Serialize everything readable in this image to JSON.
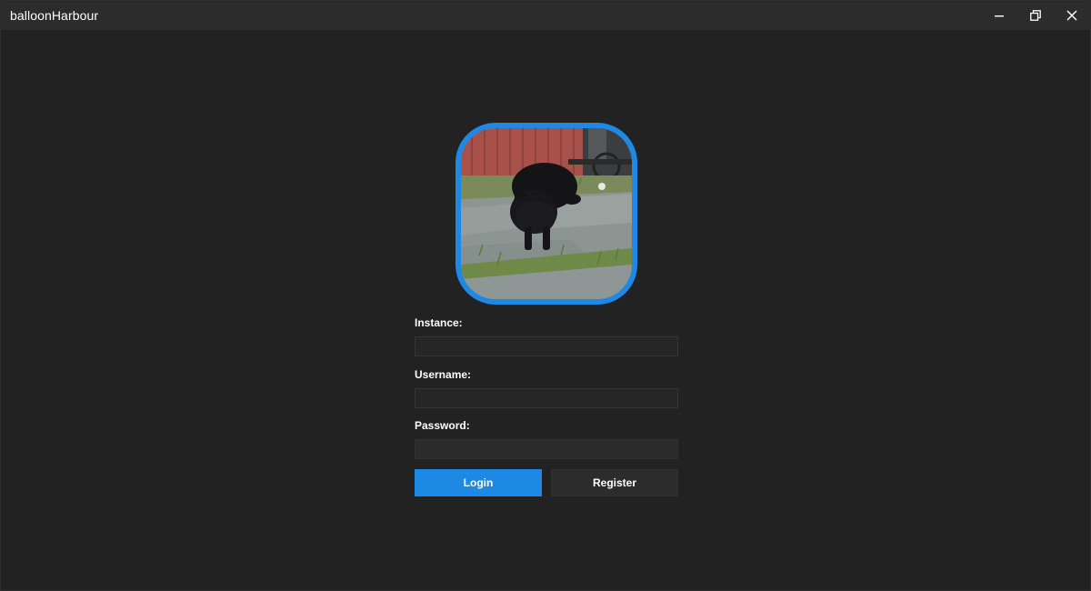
{
  "window": {
    "title": "balloonHarbour",
    "controls": [
      "minimize-icon",
      "restore-icon",
      "close-icon"
    ]
  },
  "avatar": {
    "description_icon": "cat-photo",
    "border_color": "#1e88e5"
  },
  "form": {
    "instance_label": "Instance:",
    "instance_value": "",
    "username_label": "Username:",
    "username_value": "",
    "password_label": "Password:",
    "password_value": ""
  },
  "actions": {
    "login_label": "Login",
    "register_label": "Register"
  },
  "colors": {
    "accent": "#1e88e5",
    "background": "#222222",
    "titlebar": "#2c2c2c"
  }
}
